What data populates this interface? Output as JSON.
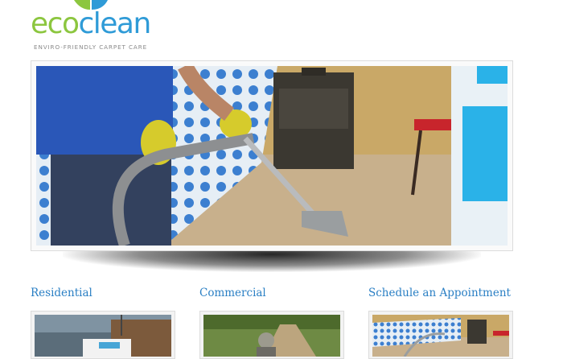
{
  "logo": {
    "eco": "eco",
    "clean": "clean",
    "tagline": "ENVIRO-FRIENDLY CARPET CARE",
    "colors": {
      "eco": "#8cc63f",
      "clean": "#2f9bd7"
    }
  },
  "hero": {
    "image": "technician-steam-cleaning-carpet"
  },
  "services": [
    {
      "title": "Residential",
      "image": "van-in-front-of-house"
    },
    {
      "title": "Commercial",
      "image": "worker-on-garden-path"
    },
    {
      "title": "Schedule an Appointment",
      "image": "bedroom-carpet-cleaning"
    }
  ],
  "theme": {
    "link": "#2a7fc4"
  }
}
